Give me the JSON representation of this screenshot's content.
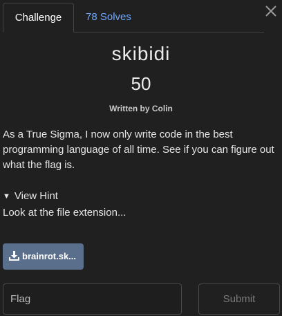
{
  "tabs": {
    "challenge": "Challenge",
    "solves": "78 Solves"
  },
  "challenge": {
    "name": "skibidi",
    "points": "50",
    "author": "Written by Colin",
    "description": "As a True Sigma, I now only write code in the best programming language of all time. See if you can figure out what the flag is."
  },
  "hint": {
    "toggle_label": "View Hint",
    "text": "Look at the file extension..."
  },
  "file": {
    "label": "brainrot.sk..."
  },
  "flag_form": {
    "placeholder": "Flag",
    "submit_label": "Submit"
  },
  "colors": {
    "accent_link": "#6ea8fe",
    "file_button": "#5a6f8c",
    "background": "#202020"
  },
  "icons": {
    "close": "close-icon",
    "download": "download-icon",
    "hint_toggle": "triangle-down-icon"
  }
}
